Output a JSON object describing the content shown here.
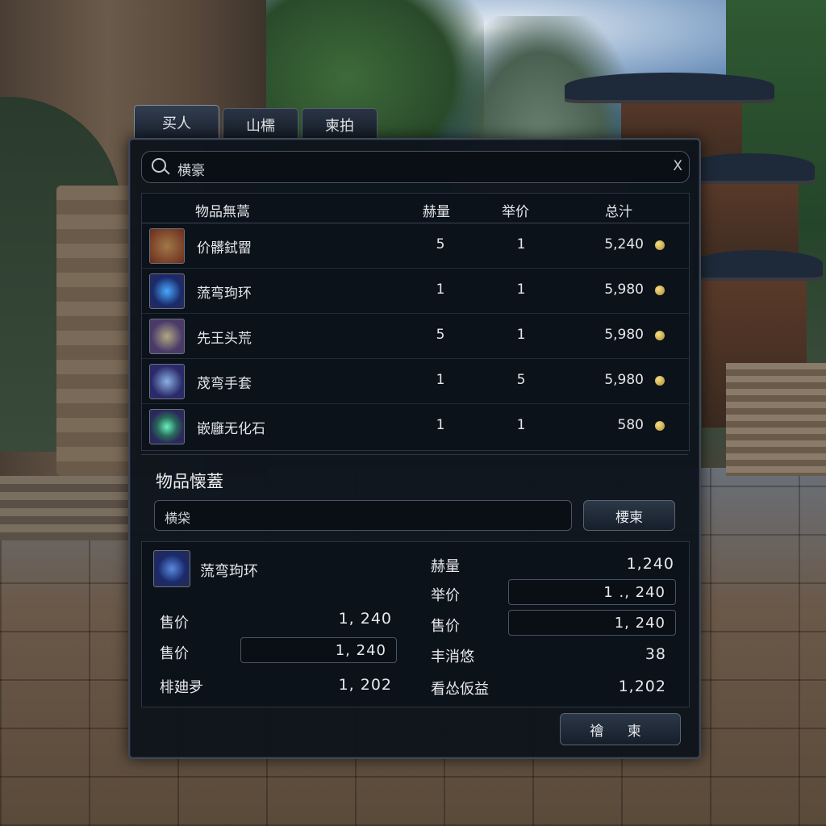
{
  "tabs": [
    {
      "label": "买人",
      "active": true
    },
    {
      "label": "山檽",
      "active": false
    },
    {
      "label": "柬拍",
      "active": false
    }
  ],
  "search": {
    "value": "横豪",
    "clear_label": "X"
  },
  "table": {
    "headers": {
      "name": "物品無蒿",
      "qty": "赫量",
      "price": "举价",
      "total": "总汁"
    },
    "rows": [
      {
        "name": "价髒鉽罶",
        "qty": "5",
        "price": "1",
        "total": "5,240",
        "icon": "helmet-item-icon",
        "color": "#8a3a2a"
      },
      {
        "name": "蓅弯玽环",
        "qty": "1",
        "price": "1",
        "total": "5,980",
        "icon": "blue-gem-ring-icon",
        "color": "#2a3a8a"
      },
      {
        "name": "先王头荒",
        "qty": "5",
        "price": "1",
        "total": "5,980",
        "icon": "crown-item-icon",
        "color": "#4a3a7a"
      },
      {
        "name": "荗弯手套",
        "qty": "1",
        "price": "5",
        "total": "5,980",
        "icon": "gauntlet-item-icon",
        "color": "#3a3a7a"
      },
      {
        "name": "嵌廱无化石",
        "qty": "1",
        "price": "1",
        "total": "580",
        "icon": "green-stone-icon",
        "color": "#3a3a6a"
      }
    ]
  },
  "item_search": {
    "title": "物品懐蓋",
    "input_value": "横柋",
    "button_label": "楆柬"
  },
  "detail": {
    "item_name": "蓅弯玽环",
    "item_icon": "blue-gem-ring-icon",
    "left": [
      {
        "label": "售价",
        "value": "1, 240",
        "field": false
      },
      {
        "label": "售价",
        "value": "1, 240",
        "field": true
      },
      {
        "label": "棑廸夛",
        "value": "1, 202",
        "field": false
      }
    ],
    "right": [
      {
        "label": "赫量",
        "value": "1,240",
        "field": false
      },
      {
        "label": "举价",
        "value": "1 ., 240",
        "field": true
      },
      {
        "label": "售价",
        "value": "1, 240",
        "field": true
      },
      {
        "label": "丰消悠",
        "value": "38",
        "field": false
      },
      {
        "label": "看怂仮益",
        "value": "1,202",
        "field": false
      }
    ]
  },
  "confirm_label": "禬 柬",
  "colors": {
    "panel_bg": "#0e141c",
    "border": "#3e4856",
    "coin": "#d8b04a"
  }
}
